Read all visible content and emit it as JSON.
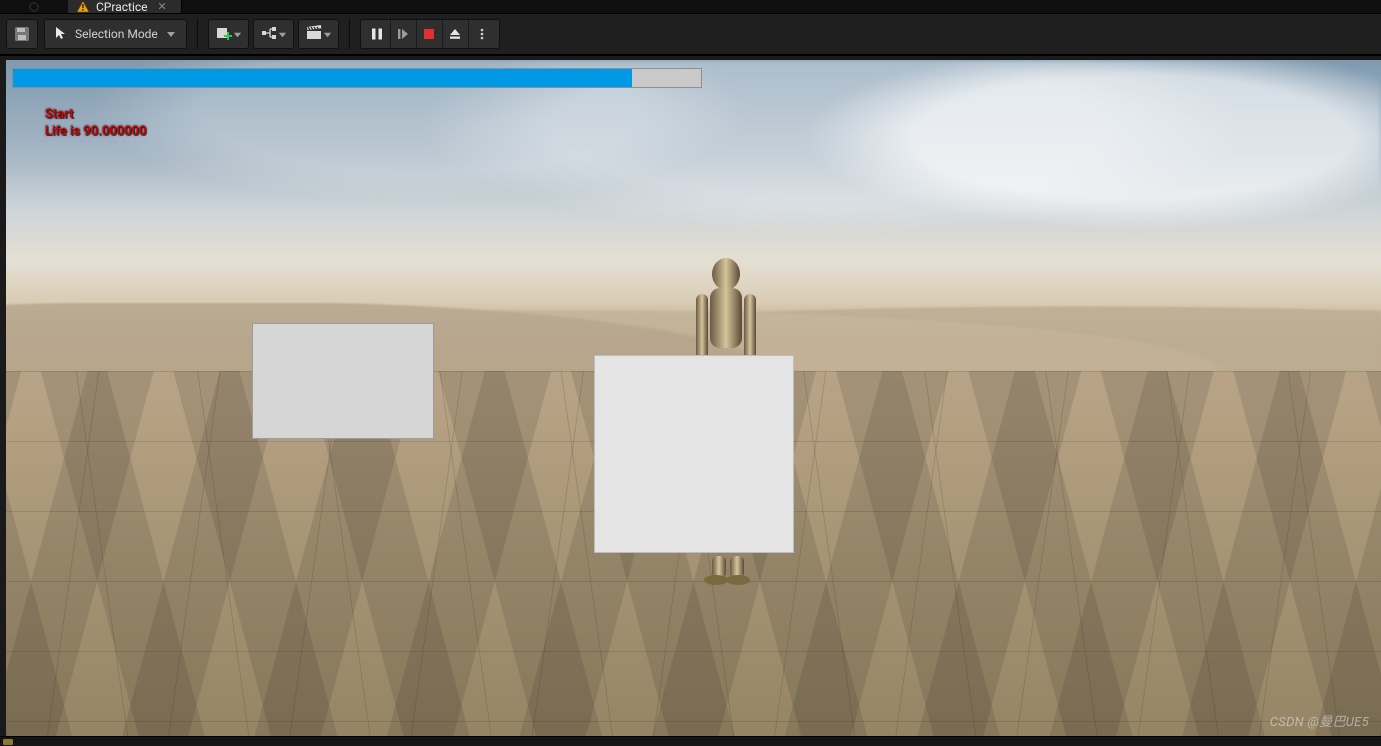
{
  "tab": {
    "label": "CPractice",
    "icon": "warning-icon"
  },
  "toolbar": {
    "mode_label": "Selection Mode"
  },
  "hud": {
    "progress_percent": 90,
    "start_label": "Start",
    "life_label": "Life is 90.000000"
  },
  "watermark": "CSDN @曼巴UE5",
  "colors": {
    "progress_fill": "#0099e6",
    "progress_track": "#c9c9c9",
    "debug_text": "#cc0000",
    "stop_button": "#e03030"
  }
}
